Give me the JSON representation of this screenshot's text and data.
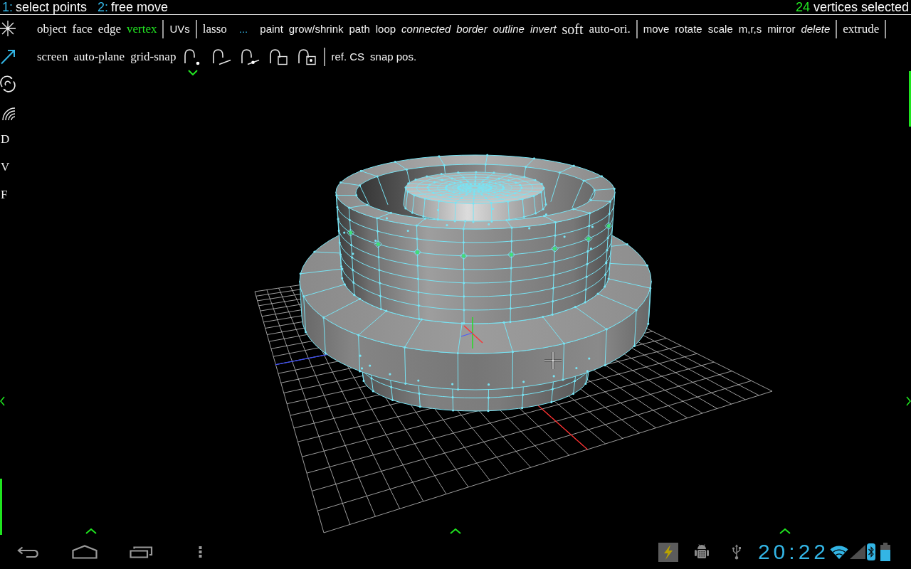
{
  "hint_bar": {
    "hints": [
      {
        "key": "1:",
        "text": "select points"
      },
      {
        "key": "2:",
        "text": "free move"
      }
    ],
    "selection": {
      "count": "24",
      "text": "vertices selected"
    }
  },
  "toolbar": {
    "rows": [
      {
        "groups": [
          {
            "items": [
              {
                "label": "object",
                "kind": "mode",
                "selected": false
              },
              {
                "label": "face",
                "kind": "mode",
                "selected": false
              },
              {
                "label": "edge",
                "kind": "mode",
                "selected": false
              },
              {
                "label": "vertex",
                "kind": "mode",
                "selected": true
              }
            ],
            "divider_after": true
          },
          {
            "items": [
              {
                "label": "UVs",
                "kind": "command",
                "selected": false
              }
            ],
            "divider_after": true
          },
          {
            "items": [
              {
                "label": "lasso",
                "kind": "mode",
                "selected": false
              },
              {
                "label": "...",
                "kind": "more",
                "selected": false
              },
              {
                "label": "paint",
                "kind": "command",
                "selected": false
              },
              {
                "label": "grow/shrink",
                "kind": "command",
                "selected": false
              },
              {
                "label": "path",
                "kind": "command",
                "selected": false
              },
              {
                "label": "loop",
                "kind": "command",
                "selected": false
              },
              {
                "label": "connected",
                "kind": "action",
                "selected": false
              },
              {
                "label": "border",
                "kind": "action",
                "selected": false
              },
              {
                "label": "outline",
                "kind": "action",
                "selected": false
              },
              {
                "label": "invert",
                "kind": "action",
                "selected": false
              },
              {
                "label": "soft",
                "kind": "toggle",
                "selected": false
              },
              {
                "label": "auto-ori.",
                "kind": "mode",
                "selected": false
              }
            ],
            "divider_after": true
          },
          {
            "items": [
              {
                "label": "move",
                "kind": "command",
                "selected": false
              },
              {
                "label": "rotate",
                "kind": "command",
                "selected": false
              },
              {
                "label": "scale",
                "kind": "command",
                "selected": false
              },
              {
                "label": "m,r,s",
                "kind": "command",
                "selected": false
              },
              {
                "label": "mirror",
                "kind": "command",
                "selected": false
              },
              {
                "label": "delete",
                "kind": "action",
                "selected": false
              }
            ],
            "divider_after": true
          },
          {
            "items": [
              {
                "label": "extrude",
                "kind": "mode",
                "selected": false
              }
            ],
            "divider_after": true
          }
        ]
      },
      {
        "groups": [
          {
            "items": [
              {
                "label": "screen",
                "kind": "mode",
                "selected": false
              },
              {
                "label": "auto-plane",
                "kind": "mode",
                "selected": false
              },
              {
                "label": "grid-snap",
                "kind": "mode",
                "selected": false
              },
              {
                "kind": "snap",
                "selected": true
              },
              {
                "kind": "snap",
                "selected": false
              },
              {
                "kind": "snap",
                "selected": false
              },
              {
                "kind": "snap",
                "selected": false
              },
              {
                "kind": "snap",
                "selected": false
              }
            ],
            "divider_after": true
          },
          {
            "items": [
              {
                "label": "ref. CS",
                "kind": "command",
                "selected": false
              },
              {
                "label": "snap pos.",
                "kind": "command",
                "selected": false
              }
            ],
            "divider_after": false
          }
        ]
      }
    ]
  },
  "sidebar": {
    "tools": [
      {
        "selected": false
      },
      {
        "selected": true
      },
      {
        "selected": false
      },
      {
        "selected": false
      }
    ],
    "letters": [
      {
        "label": "D"
      },
      {
        "label": "V"
      },
      {
        "label": "F"
      }
    ]
  },
  "nav_bar": {
    "time": "20:22"
  }
}
